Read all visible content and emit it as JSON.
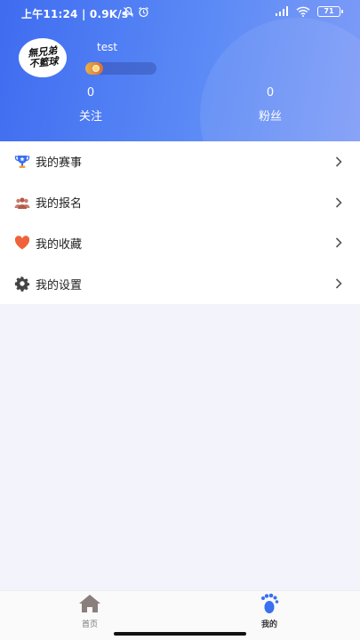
{
  "status_bar": {
    "time": "上午11:24 | 0.9K/s",
    "battery": "71"
  },
  "profile": {
    "avatar_text_line1": "無兄弟",
    "avatar_text_line2": "不籃球",
    "username": "test",
    "level_progress": 0.25,
    "following_count": "0",
    "following_label": "关注",
    "fans_count": "0",
    "fans_label": "粉丝"
  },
  "menu": {
    "items": [
      {
        "label": "我的赛事",
        "icon": "trophy-icon"
      },
      {
        "label": "我的报名",
        "icon": "group-icon"
      },
      {
        "label": "我的收藏",
        "icon": "heart-icon"
      },
      {
        "label": "我的设置",
        "icon": "gear-icon"
      }
    ]
  },
  "tabbar": {
    "home_label": "首页",
    "mine_label": "我的"
  },
  "colors": {
    "header_start": "#3f6cf0",
    "header_end": "#7f9cf7",
    "accent": "#3a6ff0",
    "heart": "#f0633a"
  }
}
